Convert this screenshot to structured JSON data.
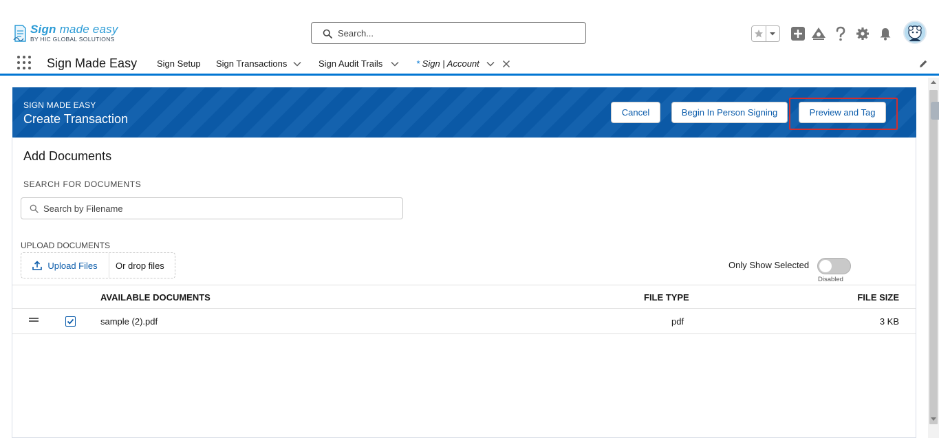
{
  "brand": {
    "logo_title_bold": "Sign",
    "logo_title_rest": " made easy",
    "logo_subtitle": "BY HIC GLOBAL SOLUTIONS",
    "accent_color": "#0176d3",
    "header_color": "#0b5cab"
  },
  "global_search": {
    "placeholder": "Search..."
  },
  "header_icons": [
    "star-icon",
    "chevron-down-icon",
    "add-icon",
    "trailhead-icon",
    "help-icon",
    "gear-icon",
    "bell-icon",
    "avatar"
  ],
  "app_nav": {
    "app_name": "Sign Made Easy",
    "items": [
      {
        "label": "Sign Setup",
        "has_dropdown": false
      },
      {
        "label": "Sign Transactions",
        "has_dropdown": true
      },
      {
        "label": "Sign Audit Trails",
        "has_dropdown": true
      }
    ],
    "active_tab": {
      "prefix": "* ",
      "label": "Sign | Account"
    }
  },
  "transaction_header": {
    "eyebrow": "SIGN MADE EASY",
    "title": "Create Transaction",
    "buttons": {
      "cancel": "Cancel",
      "begin_in_person": "Begin In Person Signing",
      "preview_and_tag": "Preview and Tag"
    }
  },
  "documents_card": {
    "title": "Add Documents",
    "search_label": "SEARCH FOR DOCUMENTS",
    "search_placeholder": "Search by Filename",
    "upload_label": "UPLOAD DOCUMENTS",
    "upload_button": "Upload Files",
    "drop_text": "Or drop files",
    "toggle_label": "Only Show Selected",
    "toggle_state": "Disabled",
    "table": {
      "columns": [
        "AVAILABLE DOCUMENTS",
        "FILE TYPE",
        "FILE SIZE"
      ],
      "rows": [
        {
          "name": "sample (2).pdf",
          "type": "pdf",
          "size": "3 KB",
          "selected": true
        }
      ]
    }
  }
}
